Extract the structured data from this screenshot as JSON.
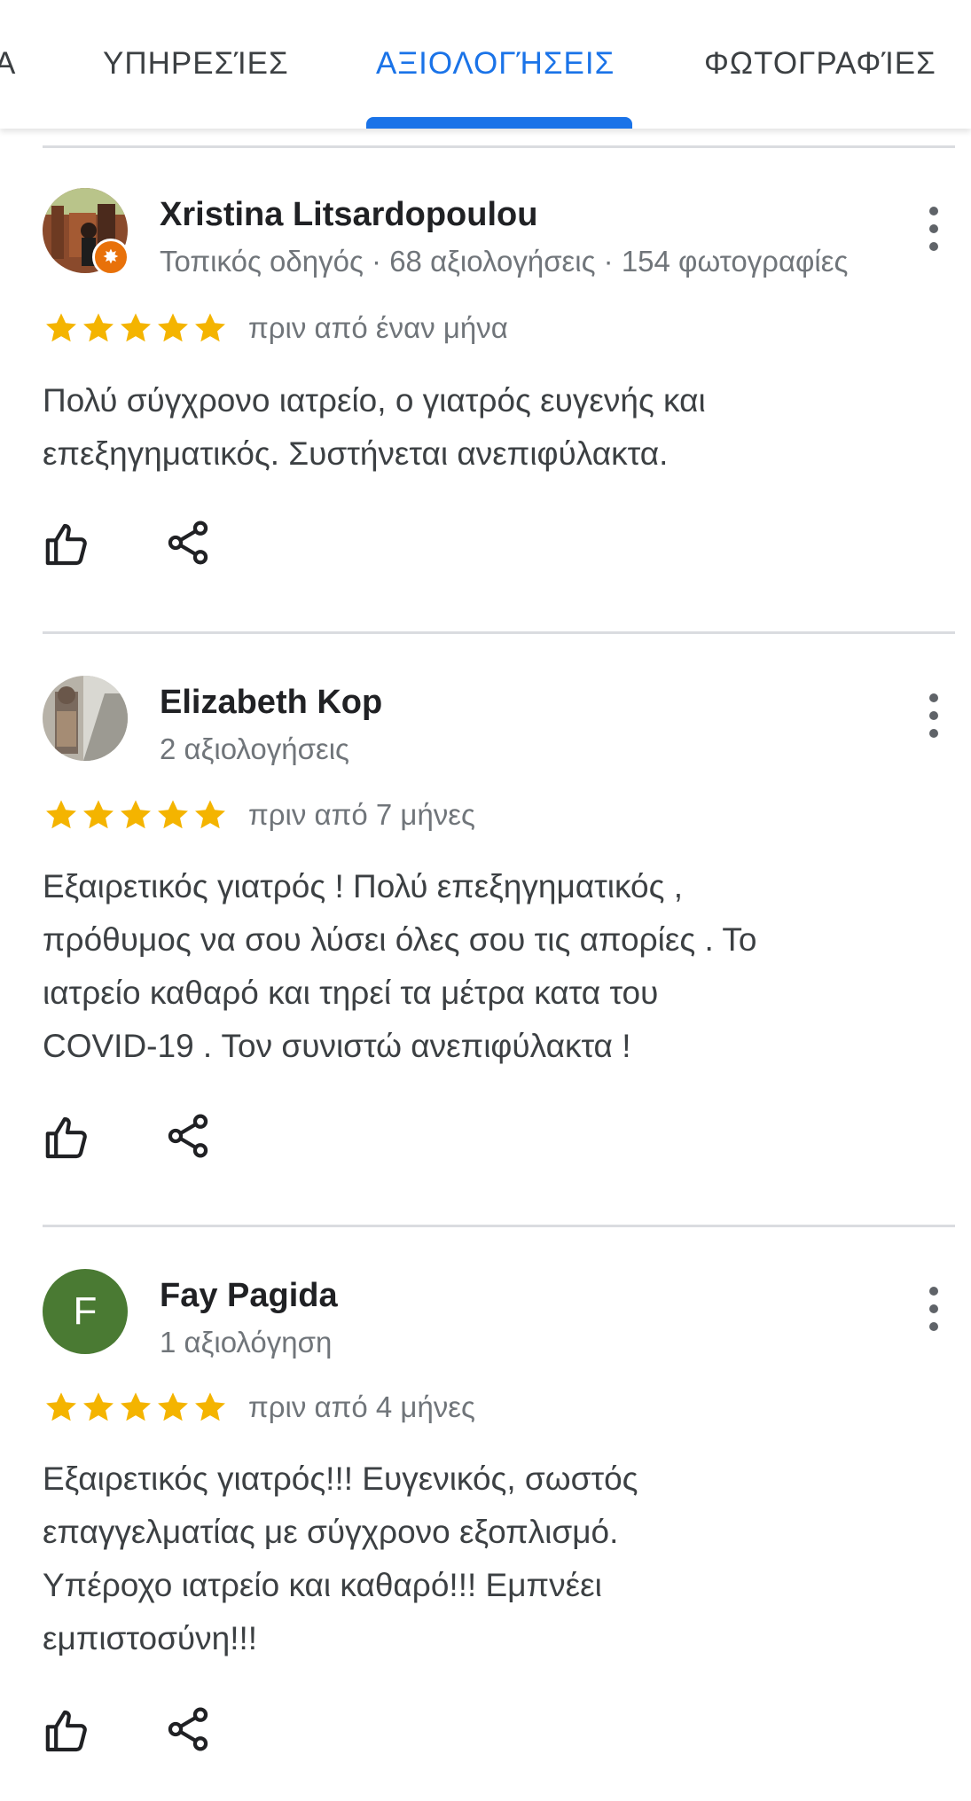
{
  "tabs": [
    {
      "label": "Α"
    },
    {
      "label": "ΥΠΗΡΕΣΊΕΣ"
    },
    {
      "label": "ΑΞΙΟΛΟΓΉΣΕΙΣ",
      "active": true
    },
    {
      "label": "ΦΩΤΟΓΡΑΦΊΕΣ"
    }
  ],
  "colors": {
    "accent": "#1a73e8",
    "star": "#f4b400",
    "guide_badge": "#e8710a",
    "letter_avatar": "#4a7a33"
  },
  "reviews": [
    {
      "author": "Xristina Litsardopoulou",
      "meta": "Τοπικός οδηγός · 68 αξιολογήσεις · 154 φωτογραφίες",
      "rating": 5,
      "time": "πριν από έναν μήνα",
      "text_lines": [
        "Πολύ σύγχρονο ιατρείο, ο γιατρός ευγενής και",
        "επεξηγηματικός. Συστήνεται ανεπιφύλακτα."
      ],
      "avatar_icon": "profile-photo",
      "badge_icon": "local-guide-star-icon"
    },
    {
      "author": "Elizabeth Kop",
      "meta": "2 αξιολογήσεις",
      "rating": 5,
      "time": "πριν από 7 μήνες",
      "text_lines": [
        "Εξαιρετικός γιατρός ! Πολύ επεξηγηματικός ,",
        "πρόθυμος να σου λύσει  όλες σου τις απορίες . Το",
        "ιατρείο καθαρό και τηρεί τα μέτρα κατα του",
        "COVID-19 .  Τον συνιστώ ανεπιφύλακτα !"
      ],
      "avatar_icon": "profile-photo"
    },
    {
      "author": "Fay Pagida",
      "meta": "1 αξιολόγηση",
      "rating": 5,
      "time": "πριν από 4 μήνες",
      "text_lines": [
        "Εξαιρετικός γιατρός!!! Ευγενικός, σωστός",
        "επαγγελματίας  με σύγχρονο εξοπλισμό.",
        "Υπέροχο  ιατρείο και καθαρό!!! Εμπνέει",
        "εμπιστοσύνη!!!"
      ],
      "avatar_letter": "F"
    }
  ]
}
